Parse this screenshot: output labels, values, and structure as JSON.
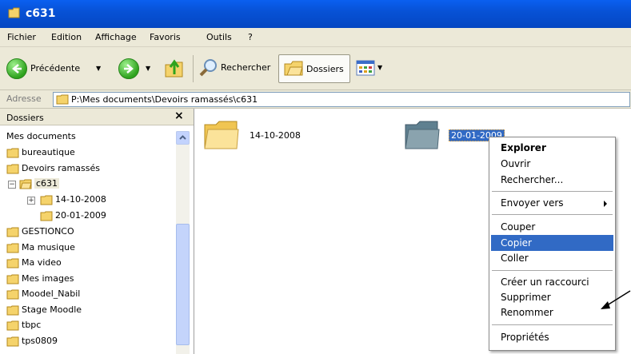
{
  "window": {
    "title": "c631"
  },
  "menubar": {
    "items": [
      "Fichier",
      "Edition",
      "Affichage",
      "Favoris",
      "Outils",
      "?"
    ]
  },
  "toolbar": {
    "back_label": "Précédente",
    "search_label": "Rechercher",
    "folders_label": "Dossiers"
  },
  "address": {
    "label": "Adresse",
    "path": "P:\\Mes documents\\Devoirs ramassés\\c631"
  },
  "folder_pane": {
    "title": "Dossiers",
    "close_glyph": "×",
    "items": [
      {
        "label": "Mes documents"
      },
      {
        "label": "bureautique"
      },
      {
        "label": "Devoirs ramassés"
      },
      {
        "label": "c631"
      },
      {
        "label": "14-10-2008"
      },
      {
        "label": "20-01-2009"
      },
      {
        "label": "GESTIONCO"
      },
      {
        "label": "Ma musique"
      },
      {
        "label": "Ma video"
      },
      {
        "label": "Mes images"
      },
      {
        "label": "Moodel_Nabil"
      },
      {
        "label": "Stage Moodle"
      },
      {
        "label": "tbpc"
      },
      {
        "label": "tps0809"
      }
    ],
    "collapse_glyph": "−",
    "expand_glyph": "+"
  },
  "content": {
    "folders": [
      {
        "label": "14-10-2008"
      },
      {
        "label": "20-01-2009"
      }
    ]
  },
  "context_menu": {
    "items": [
      {
        "label": "Explorer"
      },
      {
        "label": "Ouvrir"
      },
      {
        "label": "Rechercher..."
      },
      {
        "label": "Envoyer vers"
      },
      {
        "label": "Couper"
      },
      {
        "label": "Copier"
      },
      {
        "label": "Coller"
      },
      {
        "label": "Créer un raccourci"
      },
      {
        "label": "Supprimer"
      },
      {
        "label": "Renommer"
      },
      {
        "label": "Propriétés"
      }
    ]
  },
  "colors": {
    "titlebar": "#0752d6",
    "selection": "#316ac5",
    "chrome": "#ece9d8",
    "folder": "#f5d36b"
  },
  "icons": [
    "folder-icon",
    "back-arrow-icon",
    "forward-arrow-icon",
    "up-folder-icon",
    "search-icon",
    "views-icon",
    "close-icon",
    "submenu-arrow-icon"
  ]
}
